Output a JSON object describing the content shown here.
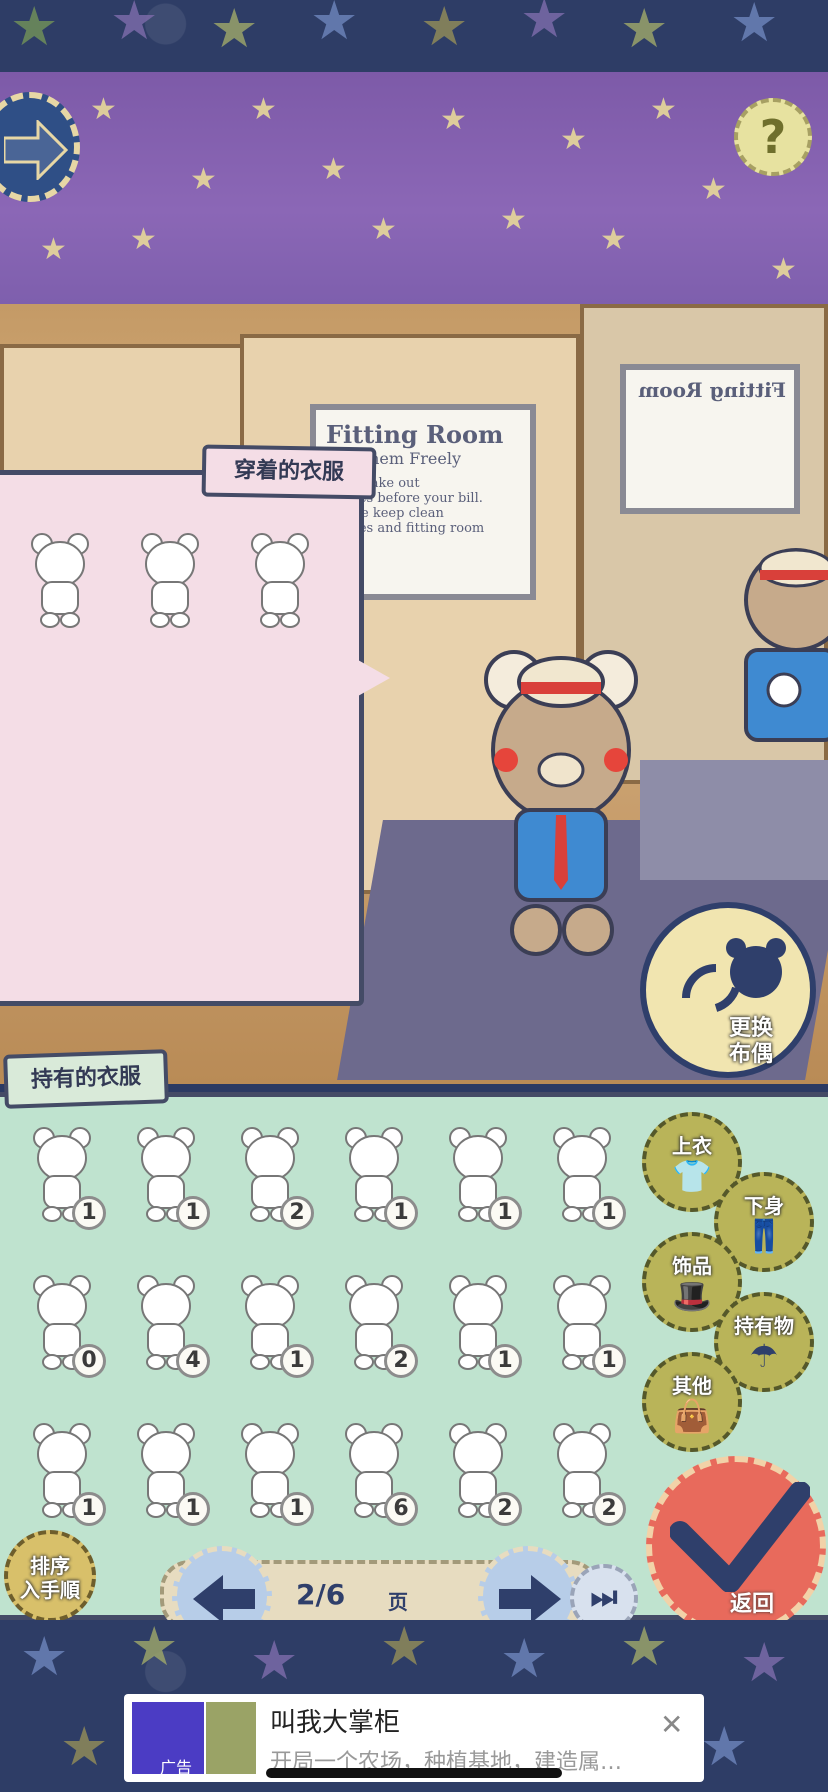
{
  "wearing": {
    "title": "穿着的衣服",
    "items": [
      "blue-jacket-bear",
      "red-tie-bear",
      "boater-hat-bear"
    ]
  },
  "owned": {
    "title": "持有的衣服",
    "items": [
      {
        "icon": "bandana-bear",
        "count": "1"
      },
      {
        "icon": "cap-bear",
        "count": "1"
      },
      {
        "icon": "mask-bear",
        "count": "2"
      },
      {
        "icon": "mushroom-hat-bear",
        "count": "1"
      },
      {
        "icon": "flower-bear",
        "count": "1"
      },
      {
        "icon": "scarf-bear",
        "count": "1"
      },
      {
        "icon": "bowler-hat-bear",
        "count": "0"
      },
      {
        "icon": "glasses-bear",
        "count": "4"
      },
      {
        "icon": "nike-cap-bear",
        "count": "1"
      },
      {
        "icon": "bag-bear",
        "count": "2"
      },
      {
        "icon": "green-hat-bear",
        "count": "1"
      },
      {
        "icon": "beret-bear",
        "count": "1"
      },
      {
        "icon": "pumpkin-bear",
        "count": "1"
      },
      {
        "icon": "yellow-scarf-bear",
        "count": "1"
      },
      {
        "icon": "pink-scarf-bear",
        "count": "1"
      },
      {
        "icon": "tie-bear",
        "count": "6"
      },
      {
        "icon": "bow-bear",
        "count": "2"
      },
      {
        "icon": "satchel-bear",
        "count": "2"
      }
    ]
  },
  "categories": {
    "tops": "上衣",
    "bottoms": "下身",
    "accessories": "饰品",
    "held_items": "持有物",
    "other": "其他"
  },
  "change_skin": "更换\n布偶",
  "return": "返回",
  "sort": "排序\n入手順",
  "pager": {
    "text": "2/6",
    "unit": "页"
  },
  "scene": {
    "sign_title": "Fitting Room",
    "sign_sub": "Try Them Freely",
    "sign_line1": "Don't take out",
    "sign_line2": "clothes before your bill.",
    "sign_line3": "Please keep clean",
    "sign_line4": "clothes and fitting room",
    "mirror_sign_title": "Fitting Room"
  },
  "ad": {
    "title": "叫我大掌柜",
    "desc": "开局一个农场，种植基地，建造属…",
    "label": "广告",
    "close": "✕"
  },
  "help": "?",
  "colors": {
    "navy": "#2e3d66",
    "purple": "#8b67b6",
    "mint": "#bfe3cf",
    "pink": "#f4dde6",
    "olive": "#b9b459",
    "coral": "#e86a5c"
  }
}
